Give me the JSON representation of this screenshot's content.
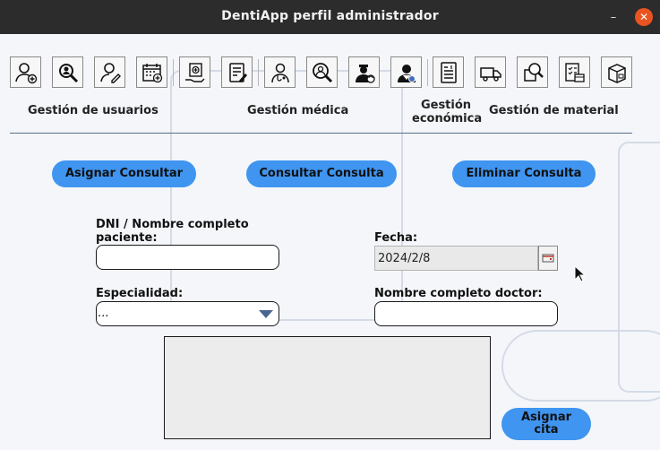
{
  "window": {
    "title": "DentiApp perfil administrador",
    "minimize_glyph": "–",
    "close_glyph": "✕"
  },
  "toolbar": {
    "icons": [
      "add-user-icon",
      "search-user-icon",
      "edit-user-icon",
      "add-calendar-icon",
      "medical-record-icon",
      "prescription-icon",
      "doctor-icon",
      "search-medical-icon",
      "doctor-refresh-icon",
      "doctor-settings-icon",
      "invoice-icon",
      "delivery-truck-icon",
      "search-box-icon",
      "inventory-checklist-icon",
      "package-box-icon"
    ]
  },
  "sections": {
    "users": "Gestión de usuarios",
    "medical": "Gestión médica",
    "economic_line1": "Gestión",
    "economic_line2": "económica",
    "material": "Gestión de material"
  },
  "actions": {
    "assign": "Asignar Consultar",
    "consult": "Consultar Consulta",
    "delete": "Eliminar Consulta"
  },
  "form": {
    "patient_label_line1": "DNI / Nombre completo",
    "patient_label_line2": "paciente:",
    "patient_value": "",
    "date_label": "Fecha:",
    "date_value": "2024/2/8",
    "specialty_label": "Especialidad:",
    "specialty_value": "...",
    "doctor_label": "Nombre completo doctor:",
    "doctor_value": "",
    "notes_value": ""
  },
  "submit": {
    "line1": "Asignar",
    "line2": "cita"
  },
  "colors": {
    "accent": "#3f95f0",
    "close": "#e95420",
    "titlebar": "#2c2c2c"
  }
}
